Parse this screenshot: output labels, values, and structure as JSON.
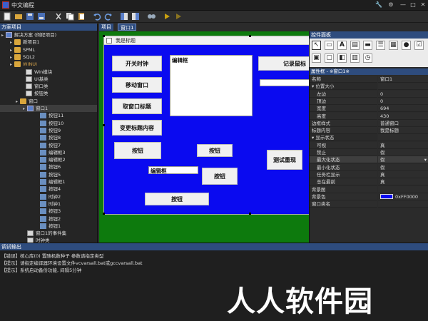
{
  "app": {
    "title": "中文编程"
  },
  "window_buttons": [
    "🔧",
    "⚙",
    "—",
    "□",
    "✕"
  ],
  "tree": {
    "header": "方案项目",
    "items": [
      {
        "label": "解决方案 (例程项目)",
        "kind": "solution"
      },
      {
        "label": "新项目1",
        "kind": "folder"
      },
      {
        "label": "SPML",
        "kind": "folder"
      },
      {
        "label": "SQL2",
        "kind": "folder"
      },
      {
        "label": "WINUI",
        "kind": "folder",
        "highlight": true
      },
      {
        "label": "Win模块",
        "kind": "file"
      },
      {
        "label": "UI基类",
        "kind": "file"
      },
      {
        "label": "窗口类",
        "kind": "file"
      },
      {
        "label": "按钮类",
        "kind": "file"
      },
      {
        "label": "窗口",
        "kind": "folder"
      },
      {
        "label": "窗口1",
        "kind": "window",
        "selected": true
      },
      {
        "label": "按钮11",
        "kind": "module"
      },
      {
        "label": "按钮10",
        "kind": "module"
      },
      {
        "label": "按钮9",
        "kind": "module"
      },
      {
        "label": "按钮8",
        "kind": "module"
      },
      {
        "label": "按钮7",
        "kind": "module"
      },
      {
        "label": "编辑框3",
        "kind": "module"
      },
      {
        "label": "编辑框2",
        "kind": "module"
      },
      {
        "label": "按钮6",
        "kind": "module"
      },
      {
        "label": "按钮5",
        "kind": "module"
      },
      {
        "label": "编辑框1",
        "kind": "module"
      },
      {
        "label": "按钮4",
        "kind": "module"
      },
      {
        "label": "时钟2",
        "kind": "module"
      },
      {
        "label": "时钟1",
        "kind": "module"
      },
      {
        "label": "按钮3",
        "kind": "module"
      },
      {
        "label": "按钮2",
        "kind": "module"
      },
      {
        "label": "按钮1",
        "kind": "module"
      },
      {
        "label": "窗口1的事件集",
        "kind": "file"
      },
      {
        "label": "时钟类",
        "kind": "file"
      }
    ]
  },
  "tabs": {
    "project": "项目",
    "window1": "窗口1"
  },
  "form": {
    "title": "我是标题",
    "btn_start_clock": "开关时钟",
    "btn_move_window": "移动窗口",
    "btn_get_title": "取窗口标题",
    "btn_change_title": "变更标题内容",
    "btn_generic": "按钮",
    "editbox_label": "编辑框",
    "btn_record_mouse": "记录鼠标",
    "btn_test_redraw": "测试重现"
  },
  "controls_panel": {
    "header": "控件面板"
  },
  "properties": {
    "header": "属性框 - ※窗口1※",
    "rows": [
      {
        "name": "名称",
        "value": "窗口1"
      },
      {
        "name": "位置大小",
        "value": "",
        "group": true
      },
      {
        "name": "左边",
        "value": "0",
        "indent": true
      },
      {
        "name": "顶边",
        "value": "0",
        "indent": true
      },
      {
        "name": "宽度",
        "value": "694",
        "indent": true
      },
      {
        "name": "高度",
        "value": "430",
        "indent": true
      },
      {
        "name": "边框样式",
        "value": "普通窗口"
      },
      {
        "name": "标题内容",
        "value": "我是标题"
      },
      {
        "name": "显示状态",
        "value": "",
        "group": true
      },
      {
        "name": "可视",
        "value": "真",
        "indent": true
      },
      {
        "name": "禁止",
        "value": "假",
        "indent": true
      },
      {
        "name": "最大化状态",
        "value": "假",
        "indent": true,
        "selected": true
      },
      {
        "name": "最小化状态",
        "value": "假",
        "indent": true
      },
      {
        "name": "任务栏显示",
        "value": "真",
        "indent": true
      },
      {
        "name": "总在最前",
        "value": "真",
        "indent": true
      },
      {
        "name": "背景图",
        "value": ""
      },
      {
        "name": "背景色",
        "value": "0xFF0000",
        "swatch": true
      },
      {
        "name": "窗口类名",
        "value": ""
      }
    ]
  },
  "debug": {
    "header": "调试输出",
    "messages": [
      "【错误】核心库(0) 置随机数种子 参数请指定类型",
      "【提示】请指定编译器环境设置文件vcvarsall.bat或gccvarsall.bat",
      "【提示】系统启动备份功能, 间隔5分钟"
    ]
  },
  "watermark": "人人软件园",
  "colors": {
    "accent": "#2e4c7e",
    "canvas": "#0d7a0d",
    "form_client": "#0a0af0"
  }
}
